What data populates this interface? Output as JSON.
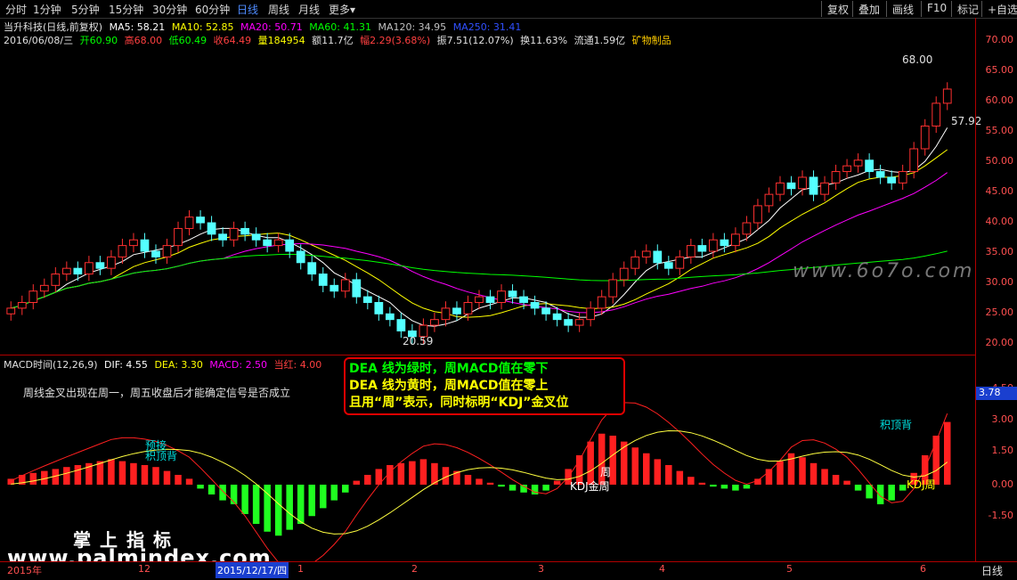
{
  "toolbar": {
    "periods": [
      "分时",
      "1分钟",
      "5分钟",
      "15分钟",
      "30分钟",
      "60分钟",
      "日线",
      "周线",
      "月线",
      "更多"
    ],
    "more_arrow": "▾",
    "right_buttons": [
      "复权",
      "叠加",
      "画线",
      "F10",
      "标记",
      "+自选"
    ]
  },
  "header": {
    "stock_title": "当升科技(日线,前复权)",
    "ma": [
      {
        "label": "MA5: 58.21",
        "color": "#ffffff"
      },
      {
        "label": "MA10: 52.85",
        "color": "#ffff00"
      },
      {
        "label": "MA20: 50.71",
        "color": "#ff00ff"
      },
      {
        "label": "MA60: 41.31",
        "color": "#00ff00"
      },
      {
        "label": "MA120: 34.95",
        "color": "#c0c0c0"
      },
      {
        "label": "MA250: 31.41",
        "color": "#3050ff"
      }
    ],
    "quote": {
      "date": "2016/06/08/三",
      "open": "开60.90",
      "high": "高68.00",
      "low": "低60.49",
      "close": "收64.49",
      "volume": "量184954",
      "amount": "额11.7亿",
      "change": "幅2.29(3.68%)",
      "amplitude": "振7.51(12.07%)",
      "turnover": "换11.63%",
      "float": "流通1.59亿",
      "industry": "矿物制品"
    }
  },
  "price_axis": [
    "70.00",
    "65.00",
    "60.00",
    "55.00",
    "50.00",
    "45.00",
    "40.00",
    "35.00",
    "30.00",
    "25.00",
    "20.00"
  ],
  "price_annotations": {
    "high_label": "68.00",
    "low_label": "20.59",
    "mid_label": "57.92"
  },
  "macd": {
    "title": "MACD时间(12,26,9)",
    "dif": "DIF: 4.55",
    "dea": "DEA: 3.30",
    "macd": "MACD: 2.50",
    "current": "当红: 4.00",
    "note": "周线金叉出现在周一，周五收盘后才能确定信号是否成立",
    "axis": [
      "4.50",
      "3.00",
      "1.50",
      "0.00",
      "-1.50"
    ],
    "current_value": "3.78",
    "tags": {
      "tag1": "预接",
      "tag2": "积顶背",
      "tag3": "周",
      "tag4": "KDJ金周",
      "tag5": "积顶背",
      "tag6": "KDJ周"
    }
  },
  "note_box": {
    "line1": "DEA 线为绿时，周MACD值在零下",
    "line2": "DEA 线为黄时，周MACD值在零上",
    "line3": "且用“周”表示，同时标明“KDJ”金叉位"
  },
  "date_axis": {
    "ticks": [
      "2015年",
      "12",
      "1",
      "2",
      "3",
      "4",
      "5",
      "6"
    ],
    "selected": "2015/12/17/四",
    "period": "日线"
  },
  "watermarks": {
    "cn": "掌上指标",
    "url": "www.palmindex.com",
    "site": "www.6o7o.com"
  },
  "chart_data": {
    "type": "candlestick",
    "title": "当升科技(日线,前复权)",
    "ylim": [
      18,
      72
    ],
    "close": [
      26,
      27,
      29,
      30,
      32,
      33,
      32,
      34,
      33,
      35,
      37,
      38,
      36,
      35,
      37,
      40,
      42,
      41,
      39,
      38,
      40,
      39,
      38,
      37,
      38,
      36,
      34,
      32,
      30,
      29,
      31,
      28,
      27,
      25,
      24,
      22,
      21,
      23,
      24,
      26,
      25,
      27,
      28,
      27,
      29,
      28,
      27,
      26,
      25,
      24,
      23,
      24,
      26,
      28,
      31,
      33,
      35,
      36,
      34,
      33,
      35,
      37,
      36,
      38,
      37,
      39,
      41,
      44,
      46,
      48,
      47,
      49,
      46,
      48,
      50,
      51,
      52,
      50,
      49,
      48,
      50,
      54,
      58,
      62,
      64.49
    ],
    "macd_hist": [
      0.3,
      0.5,
      0.6,
      0.7,
      0.8,
      0.9,
      1.0,
      1.1,
      1.2,
      1.3,
      1.2,
      1.1,
      1.0,
      0.9,
      0.7,
      0.5,
      0.3,
      -0.2,
      -0.5,
      -0.8,
      -1.0,
      -1.5,
      -2.0,
      -2.4,
      -2.6,
      -2.3,
      -2.0,
      -1.6,
      -1.2,
      -0.8,
      -0.4,
      0.2,
      0.5,
      0.8,
      1.0,
      1.1,
      1.2,
      1.3,
      1.1,
      0.9,
      0.7,
      0.5,
      0.3,
      0.1,
      -0.1,
      -0.3,
      -0.4,
      -0.5,
      -0.3,
      0.2,
      0.8,
      1.5,
      2.2,
      2.6,
      2.5,
      2.2,
      1.9,
      1.6,
      1.3,
      1.0,
      0.7,
      0.4,
      0.1,
      -0.1,
      -0.2,
      -0.3,
      -0.2,
      0.3,
      0.8,
      1.2,
      1.6,
      1.4,
      1.1,
      0.8,
      0.5,
      0.2,
      -0.3,
      -0.7,
      -1.0,
      -0.8,
      -0.3,
      0.6,
      1.5,
      2.5,
      3.2
    ]
  }
}
